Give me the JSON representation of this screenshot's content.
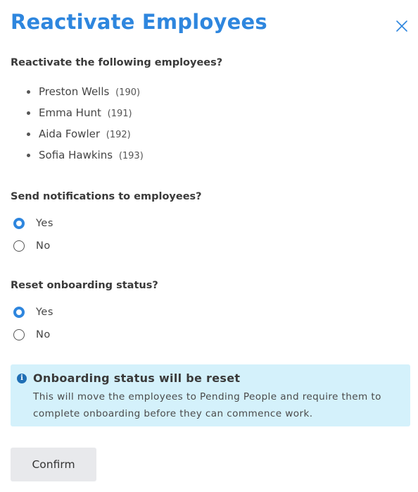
{
  "dialog": {
    "title": "Reactivate Employees",
    "close_icon": "close-icon"
  },
  "employees_section": {
    "question": "Reactivate the following employees?",
    "employees": [
      {
        "name": "Preston Wells",
        "id": "(190)"
      },
      {
        "name": "Emma Hunt",
        "id": "(191)"
      },
      {
        "name": "Aida Fowler",
        "id": "(192)"
      },
      {
        "name": "Sofia Hawkins",
        "id": "(193)"
      }
    ]
  },
  "notifications_section": {
    "question": "Send notifications to employees?",
    "options": [
      {
        "label": "Yes",
        "checked": true
      },
      {
        "label": "No",
        "checked": false
      }
    ]
  },
  "onboarding_section": {
    "question": "Reset onboarding status?",
    "options": [
      {
        "label": "Yes",
        "checked": true
      },
      {
        "label": "No",
        "checked": false
      }
    ]
  },
  "info_box": {
    "icon": "info-icon",
    "title": "Onboarding status will be reset",
    "body": "This will move the employees to Pending People and require them to complete onboarding before they can commence work."
  },
  "actions": {
    "confirm_label": "Confirm"
  },
  "colors": {
    "accent": "#2e86de",
    "info_background": "#d4f1fb",
    "button_background": "#e8e9ec"
  }
}
